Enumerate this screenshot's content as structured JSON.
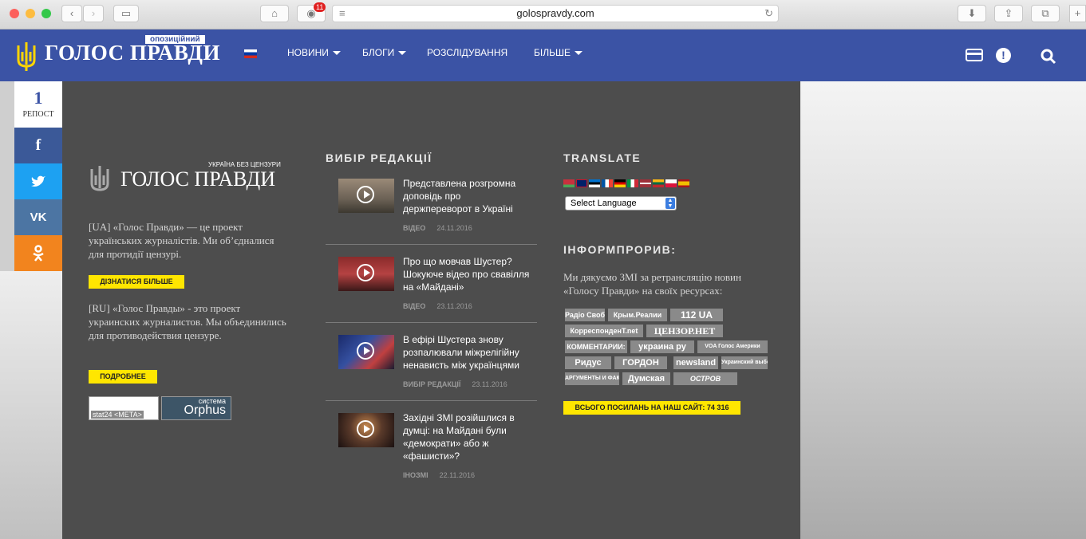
{
  "browser": {
    "url": "golospravdy.com",
    "adblock_count": "11"
  },
  "nav": {
    "logo_text": "ГОЛОС ПРАВДИ",
    "logo_badge": "опозиційний",
    "items": [
      {
        "label": "НОВИНИ"
      },
      {
        "label": "БЛОГИ"
      },
      {
        "label": "РОЗСЛІДУВАННЯ"
      },
      {
        "label": "БІЛЬШЕ"
      }
    ]
  },
  "share": {
    "count": "1",
    "count_label": "РЕПОСТ",
    "buttons": [
      {
        "icon": "f",
        "color": "#3b5998"
      },
      {
        "icon": "t",
        "color": "#1da1f2"
      },
      {
        "icon": "vk",
        "color": "#4c75a3"
      },
      {
        "icon": "ok",
        "color": "#f2841e"
      }
    ]
  },
  "about": {
    "slogan": "УКРАЇНА БЕЗ ЦЕНЗУРИ",
    "logo_text": "ГОЛОС ПРАВДИ",
    "ua_text": "[UA] «Голос Правди» — це проект українських журналістів. Ми об’єдналися для протидії цензурі.",
    "ua_button": "ДІЗНАТИСЯ БІЛЬШЕ",
    "ru_text": "[RU] «Голос Правды» - это проект украинских журналистов. Мы объединились для противодействия цензуре.",
    "ru_button": "ПОДРОБНЕЕ",
    "counter1": "stat24 <META>",
    "counter2_top": "система",
    "counter2": "Orphus"
  },
  "editors": {
    "heading": "ВИБІР РЕДАКЦІЇ",
    "items": [
      {
        "title": "Представлена розгромна доповідь про держпереворот в Україні",
        "category": "ВІДЕО",
        "date": "24.11.2016"
      },
      {
        "title": "Про що мовчав Шустер? Шокуюче відео про свавілля на «Майдані»",
        "category": "ВІДЕО",
        "date": "23.11.2016"
      },
      {
        "title": "В ефірі Шустера знову розпалювали міжрелігійну ненависть між українцями",
        "category": "ВИБІР РЕДАКЦІЇ",
        "date": "23.11.2016"
      },
      {
        "title": "Західні ЗМІ розійшлися в думці: на Майдані були «демократи» або ж «фашисти»?",
        "category": "ІНОЗМІ",
        "date": "22.11.2016"
      }
    ]
  },
  "translate": {
    "heading": "TRANSLATE",
    "select": "Select Language"
  },
  "informproryv": {
    "heading": "ІНФОРМПРОРИВ:",
    "text": "Ми дякуємо ЗМІ за ретрансляцію новин «Голосу Правди» на своїх ресурсах:",
    "sources": [
      "Радіо Свобода",
      "Крым.Реалии",
      "112 UA",
      "КорреспонденТ.net",
      "ЦЕНЗОР.НЕТ",
      "КОММЕНТАРИИ:",
      "украина ру",
      "VOA Голос Америки",
      "Ридус",
      "ГОРДОН",
      "newsland",
      "Украинский выбор",
      "АРГУМЕНТЫ И ФАКТЫ",
      "Думская",
      "ОСТРОВ"
    ],
    "total": "ВСЬОГО ПОСИЛАНЬ НА НАШ САЙТ: 74 316"
  }
}
